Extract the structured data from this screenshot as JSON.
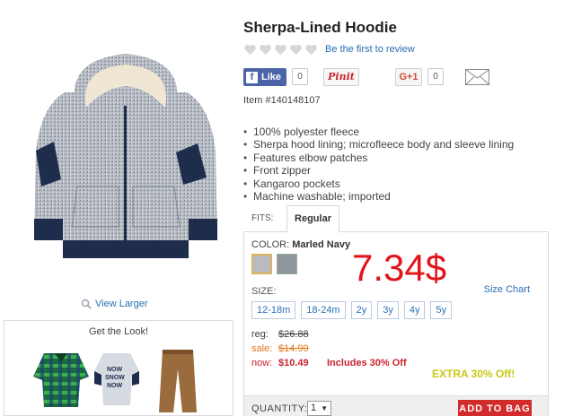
{
  "product": {
    "title": "Sherpa-Lined Hoodie",
    "review_link": "Be the first to review",
    "item_number": "Item #140148107",
    "features": [
      "100% polyester fleece",
      "Sherpa hood lining; microfleece body and sleeve lining",
      "Features elbow patches",
      "Front zipper",
      "Kangaroo pockets",
      "Machine washable; imported"
    ]
  },
  "social": {
    "facebook_label": "Like",
    "facebook_count": "0",
    "pinterest_label": "Pinit",
    "gplus_label": "G+1",
    "gplus_count": "0"
  },
  "gallery": {
    "view_larger": "View Larger",
    "get_the_look": "Get the Look!"
  },
  "fits": {
    "label": "FITS:",
    "selected": "Regular"
  },
  "options": {
    "color_label": "COLOR:",
    "color_value": "Marled Navy",
    "price_overlay": "7.34$",
    "size_label": "SIZE:",
    "size_chart": "Size Chart",
    "sizes": [
      "12-18m",
      "18-24m",
      "2y",
      "3y",
      "4y",
      "5y"
    ]
  },
  "pricing": {
    "reg_label": "reg:",
    "reg_value": "$26.88",
    "sale_label": "sale:",
    "sale_value": "$14.99",
    "now_label": "now:",
    "now_value": "$10.49",
    "includes": "Includes 30% Off",
    "extra": "EXTRA 30% Off!"
  },
  "cart": {
    "quantity_label": "QUANTITY:",
    "quantity_value": "1",
    "add_to_bag": "ADD TO BAG"
  },
  "colors": {
    "link": "#2a6fb3",
    "price_red": "#c8232c",
    "overlay_red": "#e0161b",
    "sale_orange": "#e47a1e",
    "extra_yellow": "#c9c816",
    "add_bag": "#d22b2b",
    "facebook": "#4a64a7"
  }
}
